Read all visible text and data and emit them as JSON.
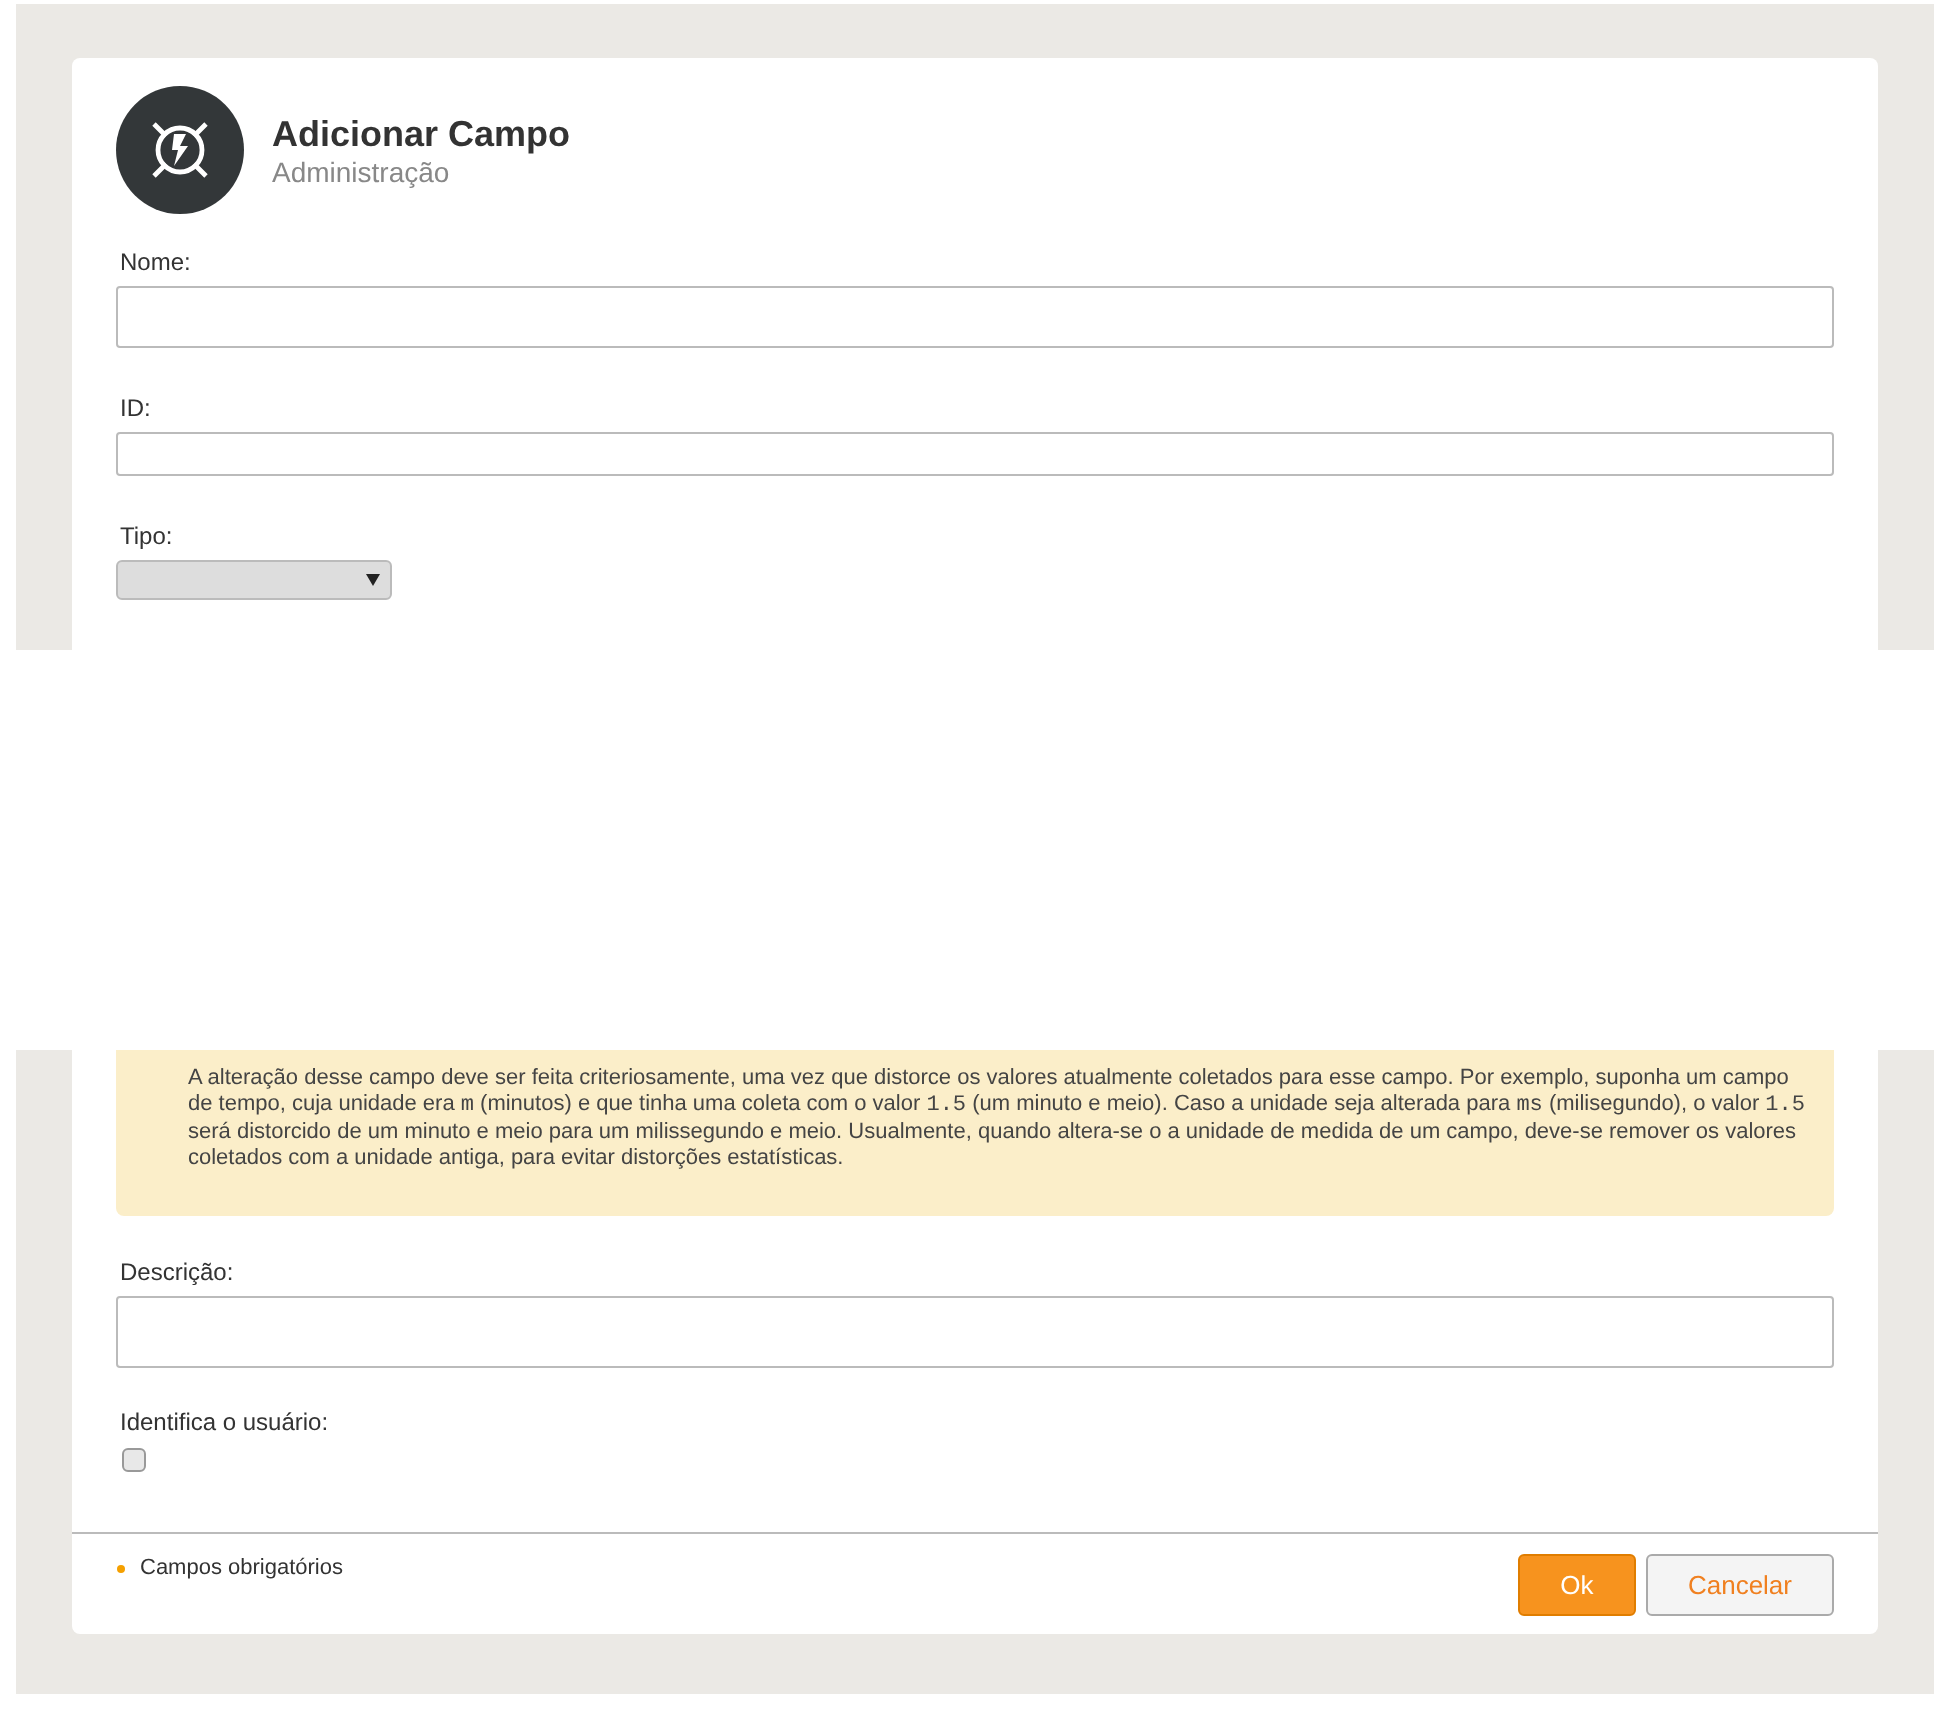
{
  "header": {
    "title": "Adicionar Campo",
    "subtitle": "Administração"
  },
  "fields": [
    {
      "kind": "text",
      "label": "Nome:"
    },
    {
      "kind": "short",
      "label": "ID:"
    },
    {
      "kind": "select",
      "label": "Tipo:"
    }
  ],
  "note": [
    {
      "kind": "text",
      "text": "A alteração desse campo deve ser feita criteriosamente, uma vez que distorce os valores atualmente coletados para esse campo. Por exemplo, suponha um campo de tempo, cuja unidade era "
    },
    {
      "kind": "code",
      "text": "m"
    },
    {
      "kind": "text",
      "text": " (minutos) e que tinha uma coleta com o valor "
    },
    {
      "kind": "code",
      "text": "1.5"
    },
    {
      "kind": "text",
      "text": " (um minuto e meio). Caso a unidade seja alterada para "
    },
    {
      "kind": "code",
      "text": "ms"
    },
    {
      "kind": "text",
      "text": " (milisegundo), o valor "
    },
    {
      "kind": "code",
      "text": "1.5"
    },
    {
      "kind": "text",
      "text": " será distorcido de um minuto e meio para um milissegundo e meio. Usualmente, quando altera-se o a unidade de medida de um campo, deve-se remover os valores coletados com a unidade antiga, para evitar distorções estatísticas."
    }
  ],
  "lower_fields": [
    {
      "kind": "textarea",
      "label": "Descrição:"
    },
    {
      "kind": "checkbox",
      "label": "Identifica o usuário:",
      "checked": false
    }
  ],
  "footer": {
    "required": "Campos obrigatórios",
    "buttons": [
      {
        "kind": "primary",
        "label": "Ok"
      },
      {
        "kind": "secondary",
        "label": "Cancelar"
      }
    ]
  }
}
